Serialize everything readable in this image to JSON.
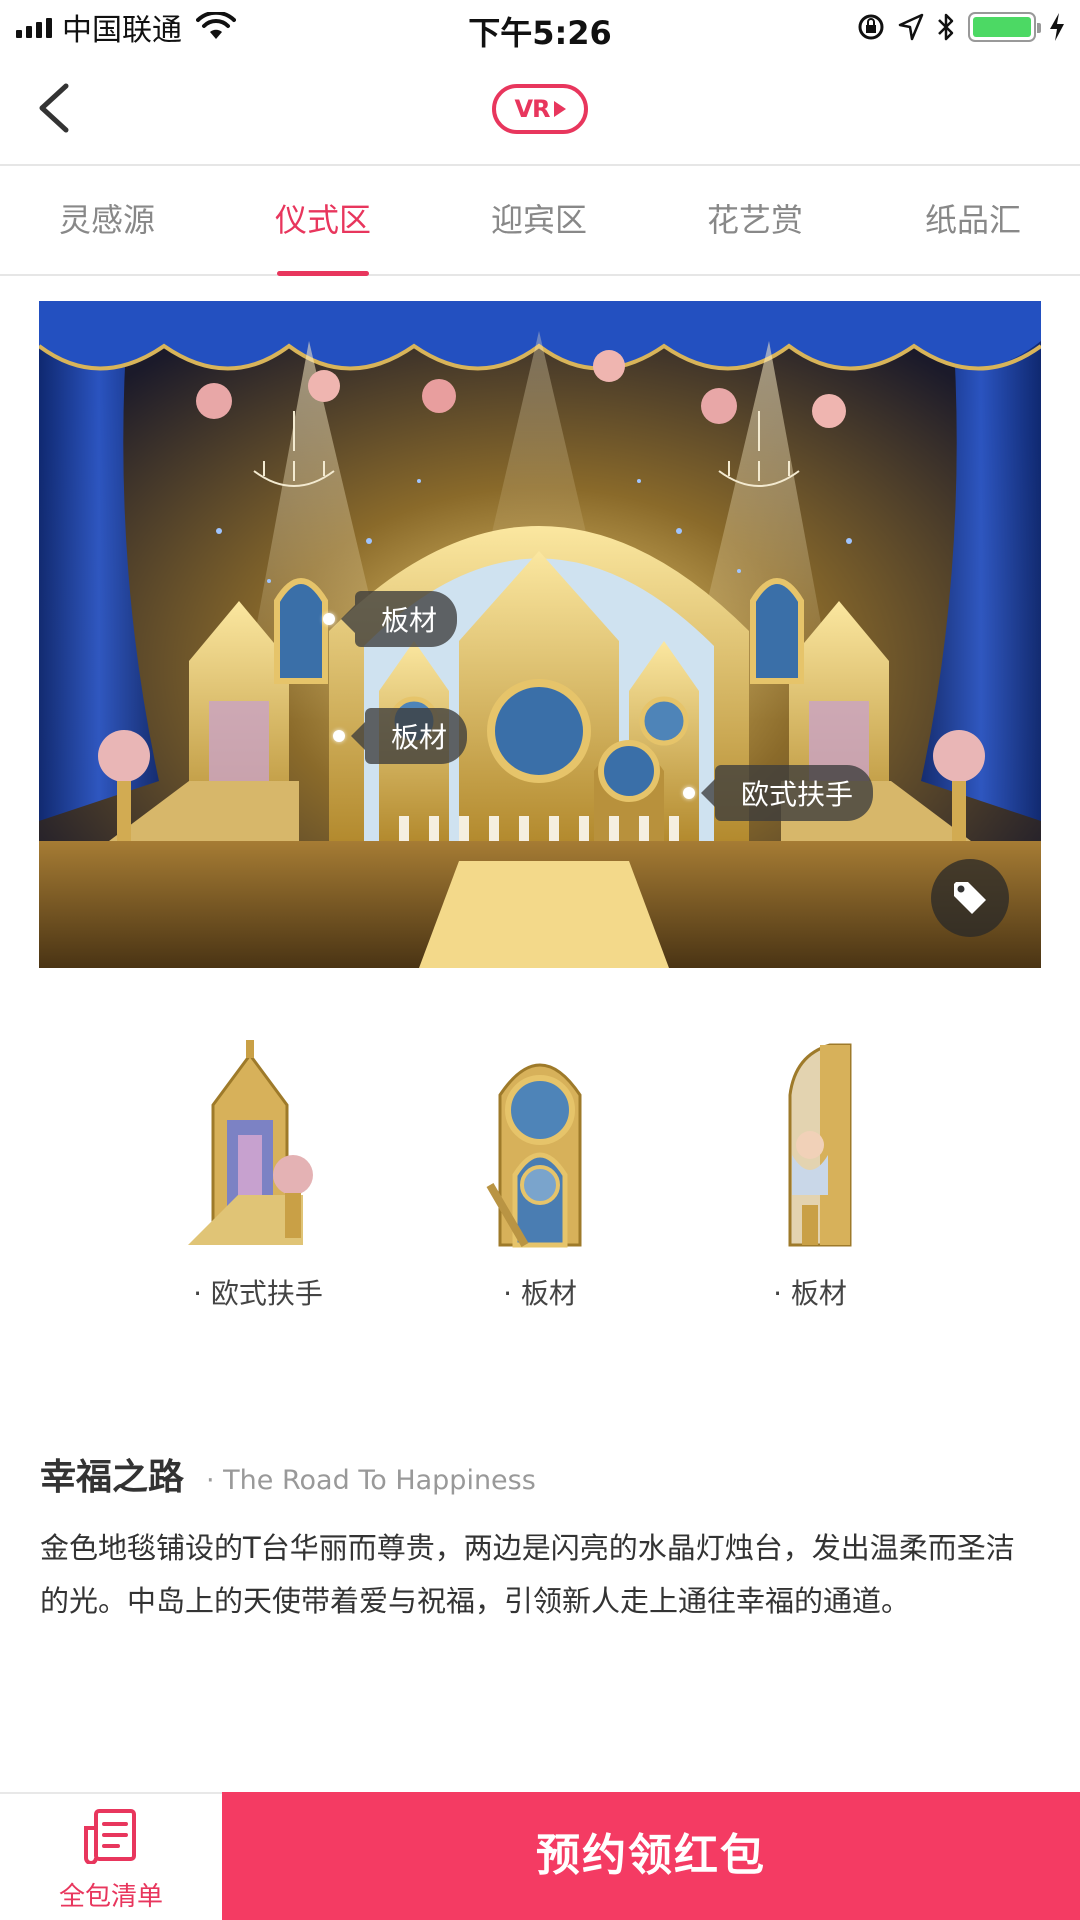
{
  "status_bar": {
    "carrier": "中国联通",
    "time": "下午5:26",
    "battery_color": "#4cd964"
  },
  "nav": {
    "back_icon": "chevron-left-icon",
    "vr_label": "VR"
  },
  "tabs": [
    {
      "label": "灵感源",
      "active": false
    },
    {
      "label": "仪式区",
      "active": true
    },
    {
      "label": "迎宾区",
      "active": false
    },
    {
      "label": "花艺赏",
      "active": false
    },
    {
      "label": "纸品汇",
      "active": false
    }
  ],
  "hero": {
    "hotspots": [
      {
        "label": "板材"
      },
      {
        "label": "板材"
      },
      {
        "label": "欧式扶手"
      }
    ],
    "tag_icon": "tag-icon"
  },
  "products": [
    {
      "label": "· 欧式扶手"
    },
    {
      "label": "· 板材"
    },
    {
      "label": "· 板材"
    }
  ],
  "description": {
    "title": "幸福之路",
    "subtitle": "· The Road To Happiness",
    "body": "金色地毯铺设的T台华丽而尊贵，两边是闪亮的水晶灯烛台，发出温柔而圣洁的光。中岛上的天使带着爱与祝福，引领新人走上通往幸福的通道。"
  },
  "bottom_bar": {
    "list_label": "全包清单",
    "reserve_label": "预约领红包"
  },
  "colors": {
    "accent": "#e8365d",
    "button": "#f43b63"
  }
}
